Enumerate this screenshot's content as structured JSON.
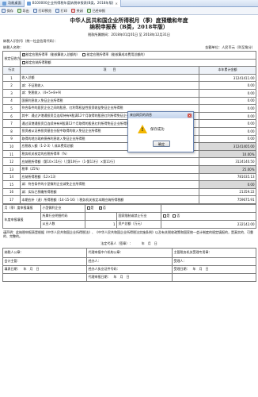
{
  "tabs": [
    {
      "label": "功能桌面"
    },
    {
      "label": "B100000企业所得税年度纳税申报表(B类，2018年版)",
      "active": true
    }
  ],
  "toolbar": {
    "save": "保存",
    "export": "导出",
    "print_preview": "打印预览",
    "print": "打印",
    "close": "关闭",
    "submit": "已经申报"
  },
  "title": {
    "line1": "中华人民共和国企业所得税月（季）度预缴和年度",
    "line2": "纳税申报表（B类，2018年版）"
  },
  "period": "税款所属期间：2018年01月01日  至  2018年12月31日",
  "taxpayer": {
    "id_label": "纳税人识别号（统一社会信用代码）：",
    "name_label": "纳税人名称：",
    "unit_label": "金额单位：人民币元（列至角分）"
  },
  "method": {
    "label": "核定征收方式",
    "opt1": "核定应税所得率（能核算收入总额的）",
    "opt2": "核定应税所得率（能核算成本费用总额的）",
    "opt3": "核定应纳所得税额"
  },
  "table": {
    "col_row": "行次",
    "col_item": "项　　目",
    "col_total": "本年累计金额",
    "rows": [
      {
        "no": "1",
        "item": "收入总额",
        "amount": "31241411.00"
      },
      {
        "no": "2",
        "item": "减：不征税收入",
        "amount": "0.00"
      },
      {
        "no": "3",
        "item": "减：免税收入（4+5+8+9）",
        "amount": "0.00"
      },
      {
        "no": "4",
        "item": "国债利息收入免征企业所得税",
        "amount": "0.00"
      },
      {
        "no": "5",
        "item": "符合条件的居民企业之间的股息、红利等权益性投资收益免征企业所得税",
        "amount": "0.00"
      },
      {
        "no": "6",
        "item": "其中：通过沪港通投资且连续持有H股满12个月取得的股息红利所得免征企业所得税",
        "amount": "0.00"
      },
      {
        "no": "7",
        "item": "通过深港通投资且连续持有H股满12个月取得的股息红利所得免征企业所得税",
        "amount": "0.00"
      },
      {
        "no": "8",
        "item": "投资者从证券投资基金分配中取得的收入免征企业所得税",
        "amount": "0.00"
      },
      {
        "no": "9",
        "item": "取得的地方政府债券利息收入免征企业所得税",
        "amount": "0.00"
      },
      {
        "no": "10",
        "item": "应税收入额（1-2-3）\\ 成本费用总额",
        "amount": "31241405.00",
        "shade": true
      },
      {
        "no": "11",
        "item": "税务机关核定的应税所得率（%）",
        "amount": "10.00%",
        "shade": true
      },
      {
        "no": "12",
        "item": "应纳税所得额（第10×11行）\\ [第10行÷（1-第11行）×第11行]",
        "amount": "3124140.50"
      },
      {
        "no": "13",
        "item": "税率（25%）",
        "amount": "25.00%",
        "shade": true
      },
      {
        "no": "14",
        "item": "应纳所得税额（12×13）",
        "amount": "781035.13"
      },
      {
        "no": "15",
        "item": "减：符合条件的小型微利企业减免企业所得税",
        "amount": "0.00",
        "shade": true
      },
      {
        "no": "16",
        "item": "减：实际已预缴所得税额",
        "amount": "21359.22"
      },
      {
        "no": "17",
        "item": "本期应补（退）所得税额（14-15-16）\\ 税务机关核定本期应纳所得税额",
        "amount": "759675.91"
      }
    ]
  },
  "footer": {
    "quarter_label": "月（季）度申报填报",
    "small_micro": "小型微利企业",
    "yes": "是",
    "no": "否",
    "annual_label": "年度申报填报",
    "industry": "所属行业明细代码",
    "state_restricted": "国家限制或禁止行业",
    "listed": "是否属于已有上市公司",
    "employees": "从业人数",
    "assets": "资产总额（万元）",
    "employees_value": "1",
    "assets_value": "232142.00",
    "decl": "谨声明：此纳税申报表是根据《中华人民共和国企业所得税法》、《中华人民共和国企业所得税法实施条例》以及有关税收政策和国家统一会计制度的规定填报的，是真实的、可靠的、完整的。",
    "legal_rep": "法定代表人（签章）：",
    "date_tail": "年　月　日",
    "company_seal": "纳税人公章：",
    "agent_seal": "代理申报中介机构公章：",
    "tax_office": "主管税务机关受理专用章：",
    "accountant": "会计主管：",
    "agent_person": "经办人：",
    "receiver": "受理人：",
    "fill_date": "填表日期：　年　月　日",
    "agent_cert": "经办人执业证件号码：",
    "agent_date": "代理申报日期：　年　月　日",
    "receive_date": "受理日期：　年　月　日"
  },
  "dialog": {
    "title": "来自网页的消息",
    "close": "×",
    "message": "保存成功",
    "ok": "确定"
  }
}
